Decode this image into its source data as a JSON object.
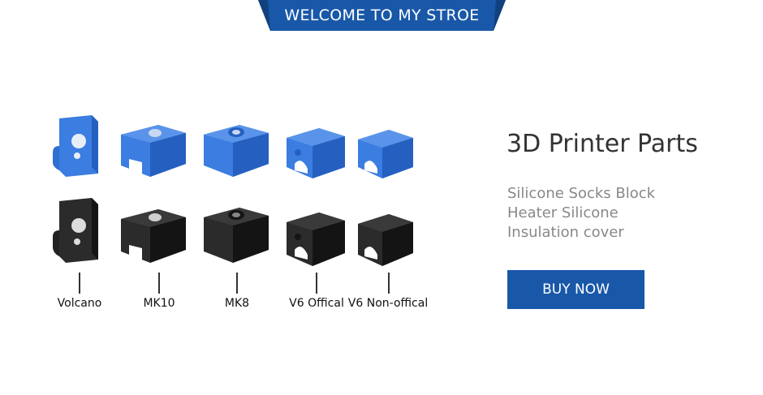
{
  "banner": {
    "text": "WELCOME TO MY STROE"
  },
  "products": {
    "labels": [
      "Volcano",
      "MK10",
      "MK8",
      "V6 Offical",
      "V6 Non-offical"
    ],
    "colors": {
      "blue": "#3b7de0",
      "blue_dark": "#2560c0",
      "black": "#2b2b2b",
      "black_dark": "#141414"
    }
  },
  "info": {
    "title": "3D Printer Parts",
    "desc_lines": [
      "Silicone Socks Block",
      "Heater Silicone",
      "Insulation cover"
    ],
    "buy_label": "BUY NOW"
  },
  "colors": {
    "accent": "#1958a8",
    "title": "#333333",
    "desc": "#888888"
  }
}
